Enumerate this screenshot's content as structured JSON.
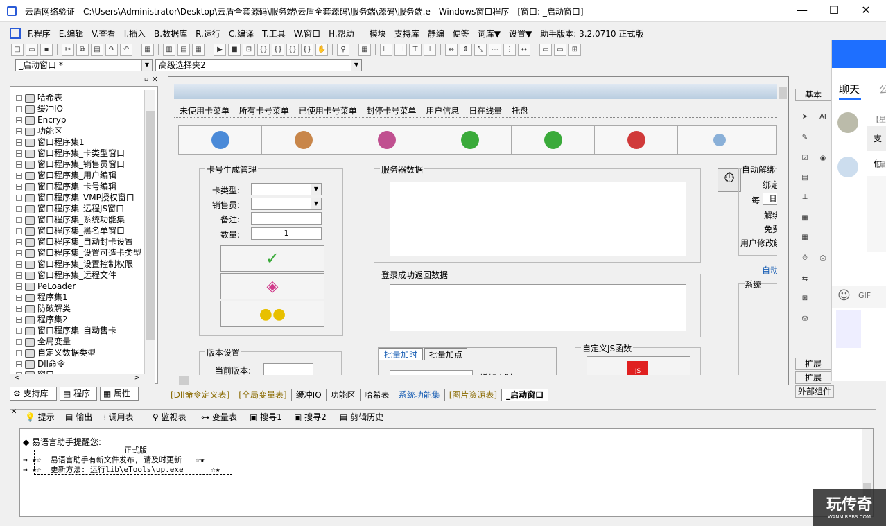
{
  "window": {
    "title": "云盾网络验证 - C:\\Users\\Administrator\\Desktop\\云盾全套源码\\服务端\\云盾全套源码\\服务端\\源码\\服务端.e - Windows窗口程序 - [窗口: _启动窗口]",
    "min": "—",
    "max": "☐",
    "close": "✕"
  },
  "menubar": {
    "items": [
      "F.程序",
      "E.编辑",
      "V.查看",
      "I.插入",
      "B.数据库",
      "R.运行",
      "C.编译",
      "T.工具",
      "W.窗口",
      "H.帮助",
      "模块",
      "支持库",
      "静编",
      "便签",
      "词库▼",
      "设置▼",
      "助手版本: 3.2.0710 正式版"
    ]
  },
  "combos": {
    "window_select": "_启动窗口 *",
    "component_select": "高级选择夹2"
  },
  "tree": {
    "items": [
      "哈希表",
      "缓冲IO",
      "Encryp",
      "功能区",
      "窗口程序集1",
      "窗口程序集_卡类型窗口",
      "窗口程序集_销售员窗口",
      "窗口程序集_用户编辑",
      "窗口程序集_卡号编辑",
      "窗口程序集_VMP授权窗口",
      "窗口程序集_远程JS窗口",
      "窗口程序集_系统功能集",
      "窗口程序集_黑名单窗口",
      "窗口程序集_自动封卡设置",
      "窗口程序集_设置可造卡类型",
      "窗口程序集_设置控制权限",
      "窗口程序集_远程文件",
      "PeLoader",
      "程序集1",
      "防破解类",
      "程序集2",
      "窗口程序集_自动售卡",
      "全局变量",
      "自定义数据类型",
      "Dll命令",
      "窗口"
    ]
  },
  "left_tabs": [
    "支持库",
    "程序",
    "属性"
  ],
  "form": {
    "menu": [
      "未使用卡菜单",
      "所有卡号菜单",
      "已使用卡号菜单",
      "封停卡号菜单",
      "用户信息",
      "日在线量",
      "托盘"
    ],
    "card_group": {
      "title": "卡号生成管理",
      "card_type_label": "卡类型:",
      "seller_label": "销售员:",
      "note_label": "备注:",
      "count_label": "数量:",
      "count_value": "1"
    },
    "server_data_title": "服务器数据",
    "login_return_title": "登录成功返回数据",
    "version_group": {
      "title": "版本设置",
      "current_label": "当前版本:"
    },
    "tabs": [
      "批量加时",
      "批量加点"
    ],
    "add_time_label": "增加小时",
    "js_title": "自定义JS函数",
    "right_group": {
      "title": "自动解绑",
      "lines": [
        "绑定",
        "每",
        "解绑",
        "免费",
        "用户修改绑"
      ],
      "every_value": "日",
      "auto": "自动",
      "system": "系统"
    }
  },
  "bottom_tabs": [
    "[Dll命令定义表]",
    "[全局变量表]",
    "缓冲IO",
    "功能区",
    "哈希表",
    "系统功能集",
    "[图片资源表]",
    "_启动窗口"
  ],
  "right_panel": {
    "top": "基本",
    "ext1": "扩展",
    "ext2": "扩展",
    "external": "外部组件"
  },
  "chat": {
    "tab_chat": "聊天",
    "tab2": "公",
    "name1": "【星",
    "msg1": "支付",
    "name2": "【星",
    "gif": "GIF"
  },
  "output_tabs": [
    "提示",
    "输出",
    "调用表",
    "监视表",
    "变量表",
    "搜寻1",
    "搜寻2",
    "剪辑历史"
  ],
  "output": {
    "line1": "◆ 易语言助手提醒您:",
    "boxtitle": "正式版",
    "line2": "→ ★☆  易语言助手有新文件发布, 请及时更新   ☆★",
    "line3": "→ ★☆  更新方法: 运行lib\\eTools\\up.exe      ☆★"
  },
  "watermark": {
    "text": "玩传奇",
    "sub": "WANMIRBBS.COM"
  }
}
